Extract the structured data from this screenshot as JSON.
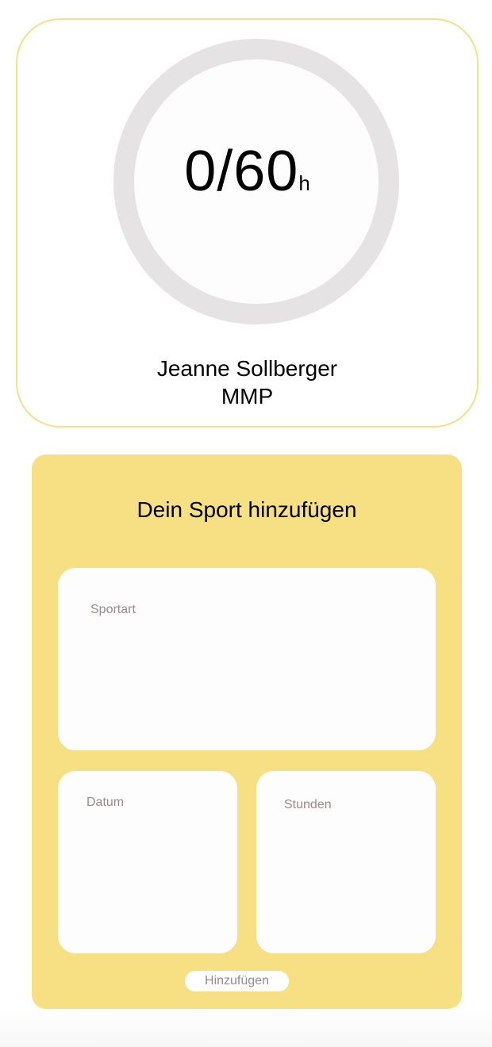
{
  "progress": {
    "current": "0",
    "separator": "/",
    "goal": "60",
    "unit": "h",
    "fill_fraction": 0
  },
  "user": {
    "name": "Jeanne Sollberger",
    "class": "MMP"
  },
  "form": {
    "title": "Dein Sport hinzufügen",
    "sport_placeholder": "Sportart",
    "date_placeholder": "Datum",
    "hours_placeholder": "Stunden",
    "submit_label": "Hinzufügen"
  },
  "colors": {
    "accent_yellow": "#f7e084",
    "card_border": "#f5e08a",
    "ring_track": "#e5e3e4",
    "placeholder_text": "#9a8b8a"
  }
}
